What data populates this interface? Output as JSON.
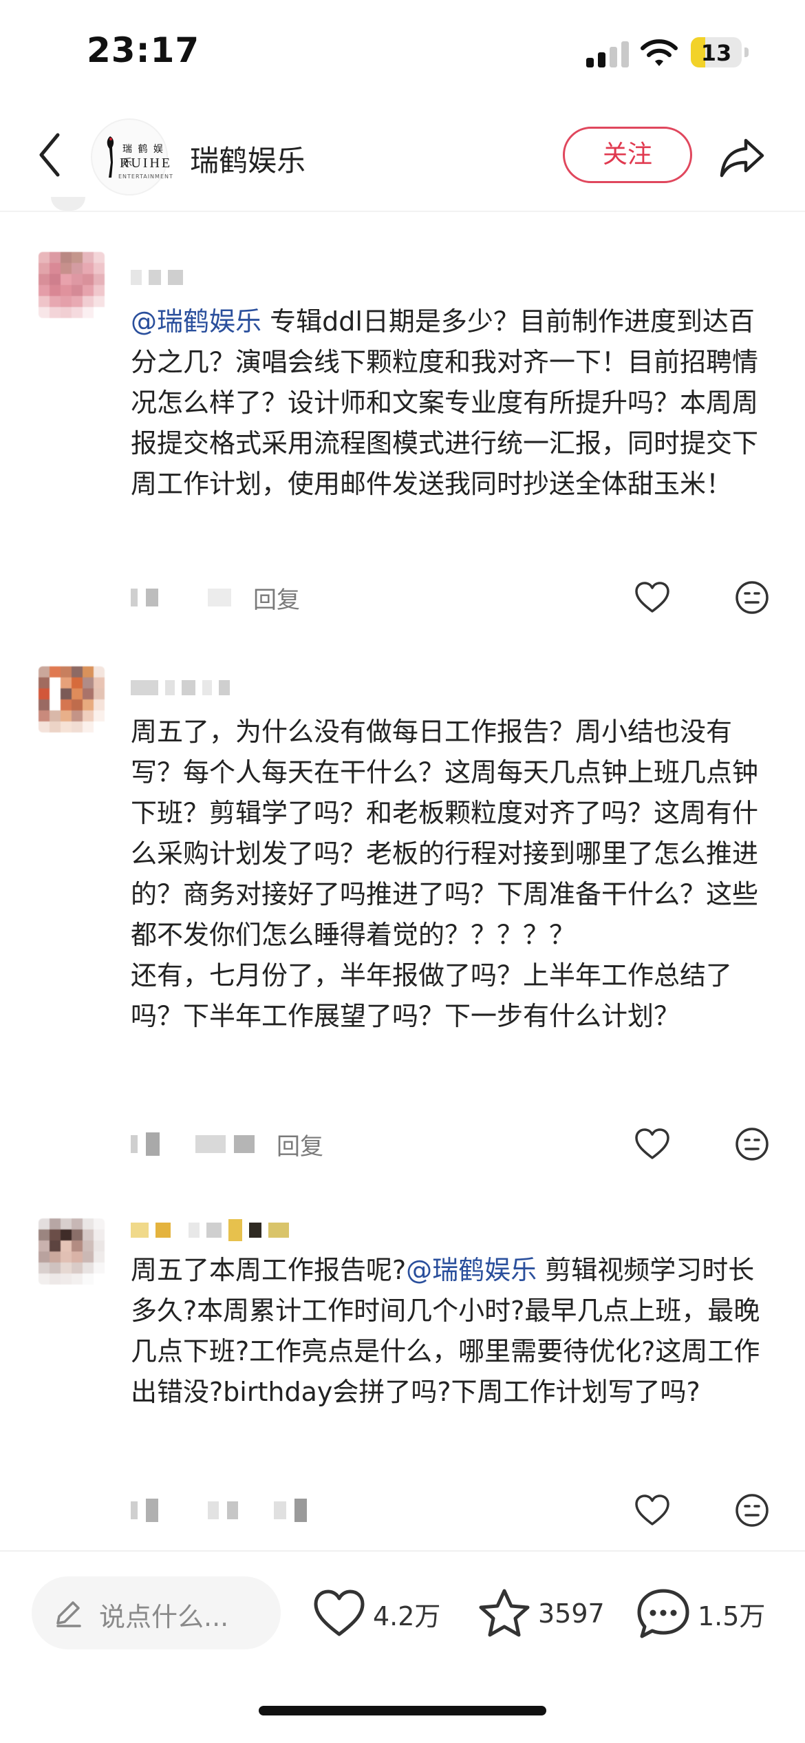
{
  "status_bar": {
    "time": "23:17",
    "battery_level": "13",
    "battery_color": "#f2d229",
    "icons": [
      "signal-icon",
      "wifi-icon",
      "battery-icon"
    ]
  },
  "header": {
    "back_icon": "chevron-left-icon",
    "logo": {
      "line1": "瑞 鹤 娱 乐",
      "line2": "RUIHE",
      "line3": "ENTERTAINMENT"
    },
    "account_name": "瑞鹤娱乐",
    "follow_label": "关注",
    "follow_color": "#e0394f",
    "share_icon": "share-arrow-icon"
  },
  "comments": [
    {
      "mention": "@瑞鹤娱乐",
      "text": " 专辑ddl日期是多少？目前制作进度到达百分之几？演唱会线下颗粒度和我对齐一下！目前招聘情况怎么样了？设计师和文案专业度有所提升吗？本周周报提交格式采用流程图模式进行统一汇报，同时提交下周工作计划，使用邮件发送我同时抄送全体甜玉米！",
      "reply_label": "回复",
      "like_icon": "heart-outline-icon",
      "dislike_icon": "meh-face-icon"
    },
    {
      "text": "周五了，为什么没有做每日工作报告？周小结也没有写？每个人每天在干什么？这周每天几点钟上班几点钟下班？剪辑学了吗？和老板颗粒度对齐了吗？这周有什么采购计划发了吗？老板的行程对接到哪里了怎么推进的？商务对接好了吗推进了吗？下周准备干什么？这些都不发你们怎么睡得着觉的？？？？？\n还有，七月份了，半年报做了吗？上半年工作总结了吗？下半年工作展望了吗？下一步有什么计划？",
      "reply_label": "回复",
      "like_icon": "heart-outline-icon",
      "dislike_icon": "meh-face-icon"
    },
    {
      "prefix": "周五了本周工作报告呢?",
      "mention": "@瑞鹤娱乐",
      "text": " 剪辑视频学习时长多久?本周累计工作时间几个小时?最早几点上班，最晚几点下班?工作亮点是什么，哪里需要待优化?这周工作出错没?birthday会拼了吗?下周工作计划写了吗?",
      "like_icon": "heart-outline-icon",
      "dislike_icon": "meh-face-icon"
    }
  ],
  "bottom_bar": {
    "input_placeholder": "说点什么...",
    "likes": "4.2万",
    "favorites": "3597",
    "comments": "1.5万",
    "icons": [
      "pencil-icon",
      "heart-outline-icon",
      "star-outline-icon",
      "comment-bubble-icon"
    ]
  }
}
